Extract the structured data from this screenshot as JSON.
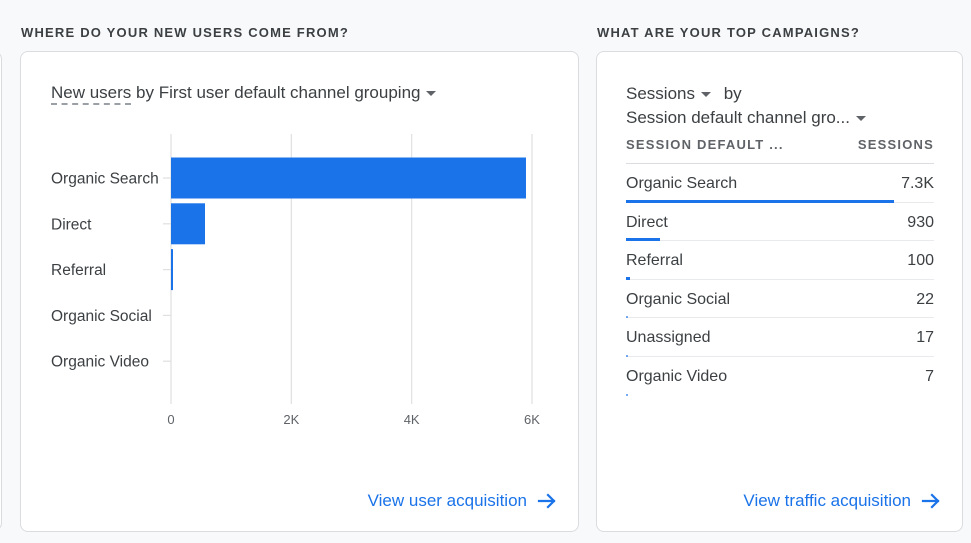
{
  "sections": {
    "users_title": "WHERE DO YOUR NEW USERS COME FROM?",
    "campaigns_title": "WHAT ARE YOUR TOP CAMPAIGNS?"
  },
  "users_card": {
    "metric": "New users",
    "by_text": " by First user default channel grouping",
    "link_label": "View user acquisition",
    "accent": "#1a73e8"
  },
  "chart_data": {
    "type": "bar",
    "orientation": "horizontal",
    "title": "New users by First user default channel grouping",
    "categories": [
      "Organic Search",
      "Direct",
      "Referral",
      "Organic Social",
      "Organic Video"
    ],
    "values": [
      5900,
      565,
      30,
      0,
      0
    ],
    "xlim": [
      0,
      6000
    ],
    "xticks": [
      0,
      2000,
      4000,
      6000
    ],
    "xtick_labels": [
      "0",
      "2K",
      "4K",
      "6K"
    ],
    "xlabel": "",
    "ylabel": "",
    "grid": true,
    "color": "#1a73e8"
  },
  "campaigns_card": {
    "metric": "Sessions",
    "by": "by",
    "dimension": "Session default channel gro...",
    "col_dimension": "SESSION DEFAULT ...",
    "col_metric": "SESSIONS",
    "rows": [
      {
        "label": "Organic Search",
        "value": "7.3K",
        "share": 1.0
      },
      {
        "label": "Direct",
        "value": "930",
        "share": 0.127
      },
      {
        "label": "Referral",
        "value": "100",
        "share": 0.014
      },
      {
        "label": "Organic Social",
        "value": "22",
        "share": 0.003
      },
      {
        "label": "Unassigned",
        "value": "17",
        "share": 0.002
      },
      {
        "label": "Organic Video",
        "value": "7",
        "share": 0.001
      }
    ],
    "link_label": "View traffic acquisition"
  }
}
